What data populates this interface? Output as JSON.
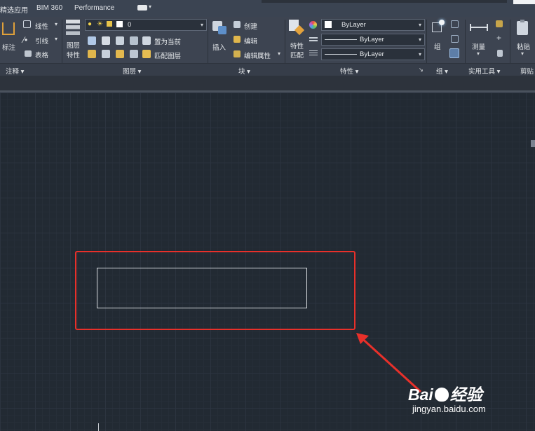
{
  "tabs": [
    "精选应用",
    "BIM 360",
    "Performance"
  ],
  "ribbon": {
    "annotation": {
      "dim_label": "标注",
      "linear_label": "线性",
      "leader_label": "引线",
      "table_label": "表格",
      "panel_label": "注释"
    },
    "layers": {
      "layer_props_label_1": "图层",
      "layer_props_label_2": "特性",
      "current_layer_value": "0",
      "set_current_label": "置为当前",
      "match_layer_label": "匹配图层",
      "panel_label": "图层"
    },
    "block": {
      "insert_label": "插入",
      "create_label": "创建",
      "edit_label": "编辑",
      "edit_attr_label": "编辑属性",
      "panel_label": "块"
    },
    "properties": {
      "match_label_1": "特性",
      "match_label_2": "匹配",
      "color_value": "ByLayer",
      "linetype_value": "ByLayer",
      "lineweight_value": "ByLayer",
      "panel_label": "特性"
    },
    "group": {
      "group_label": "组",
      "panel_label": "组"
    },
    "utilities": {
      "measure_label": "测量",
      "panel_label": "实用工具"
    },
    "clipboard": {
      "paste_label": "粘贴",
      "panel_label": "剪贴"
    }
  },
  "watermark": {
    "url": "jingyan.baidu.com"
  },
  "colors": {
    "highlight": "#e8302a",
    "ribbon_bg": "#3d4451",
    "canvas_bg": "#222a33"
  }
}
